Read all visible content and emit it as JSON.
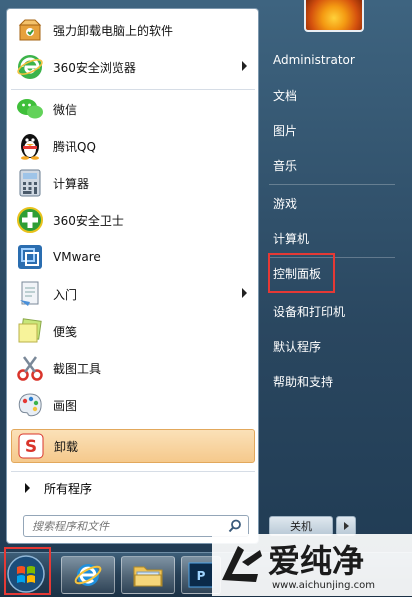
{
  "left_items": [
    {
      "label": "强力卸载电脑上的软件",
      "icon": "uninstall-box-icon",
      "arrow": false
    },
    {
      "label": "360安全浏览器",
      "icon": "360-browser-icon",
      "arrow": true
    },
    {
      "label": "微信",
      "icon": "wechat-icon",
      "arrow": false
    },
    {
      "label": "腾讯QQ",
      "icon": "qq-penguin-icon",
      "arrow": false
    },
    {
      "label": "计算器",
      "icon": "calculator-icon",
      "arrow": false
    },
    {
      "label": "360安全卫士",
      "icon": "360-guard-icon",
      "arrow": false
    },
    {
      "label": "VMware",
      "icon": "vmware-icon",
      "arrow": false
    },
    {
      "label": "入门",
      "icon": "getting-started-icon",
      "arrow": true
    },
    {
      "label": "便笺",
      "icon": "sticky-notes-icon",
      "arrow": false
    },
    {
      "label": "截图工具",
      "icon": "snipping-tool-icon",
      "arrow": false
    },
    {
      "label": "画图",
      "icon": "paint-icon",
      "arrow": false
    },
    {
      "label": "卸载",
      "icon": "uninstall-s-icon",
      "arrow": false
    }
  ],
  "all_programs": "所有程序",
  "search": {
    "placeholder": "搜索程序和文件",
    "icon": "search-icon"
  },
  "right_items": [
    "Administrator",
    "文档",
    "图片",
    "音乐",
    "游戏",
    "计算机",
    "控制面板",
    "设备和打印机",
    "默认程序",
    "帮助和支持"
  ],
  "shutdown_label": "关机",
  "watermark": {
    "brand": "爱纯净",
    "url": "www.aichunjing.com"
  },
  "colors": {
    "highlight_border": "#e53935",
    "hover_item": "#f5c98c"
  }
}
